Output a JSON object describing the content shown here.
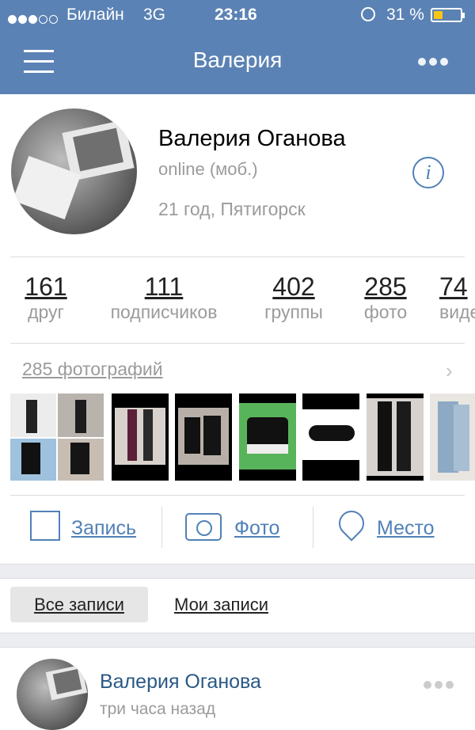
{
  "status_bar": {
    "carrier": "Билайн",
    "network": "3G",
    "time": "23:16",
    "battery_percent": "31 %",
    "battery_level": 0.31
  },
  "header": {
    "title": "Валерия",
    "menu_icon": "hamburger-icon",
    "more_icon": "ellipsis-icon"
  },
  "profile": {
    "name": "Валерия Оганова",
    "status": "online (моб.)",
    "details": "21 год, Пятигорск"
  },
  "stats": [
    {
      "count": "161",
      "label": "друг"
    },
    {
      "count": "111",
      "label": "подписчиков"
    },
    {
      "count": "402",
      "label": "группы"
    },
    {
      "count": "285",
      "label": "фото"
    },
    {
      "count": "74",
      "label": "видео"
    }
  ],
  "photos": {
    "link": "285 фотографий"
  },
  "actions": {
    "post": "Запись",
    "photo": "Фото",
    "place": "Место"
  },
  "tabs": {
    "all": "Все записи",
    "mine": "Мои записи"
  },
  "post": {
    "author": "Валерия Оганова",
    "time": "три часа назад"
  },
  "colors": {
    "header": "#5b82b4",
    "accent": "#5181b8",
    "battery": "#f5c518"
  }
}
